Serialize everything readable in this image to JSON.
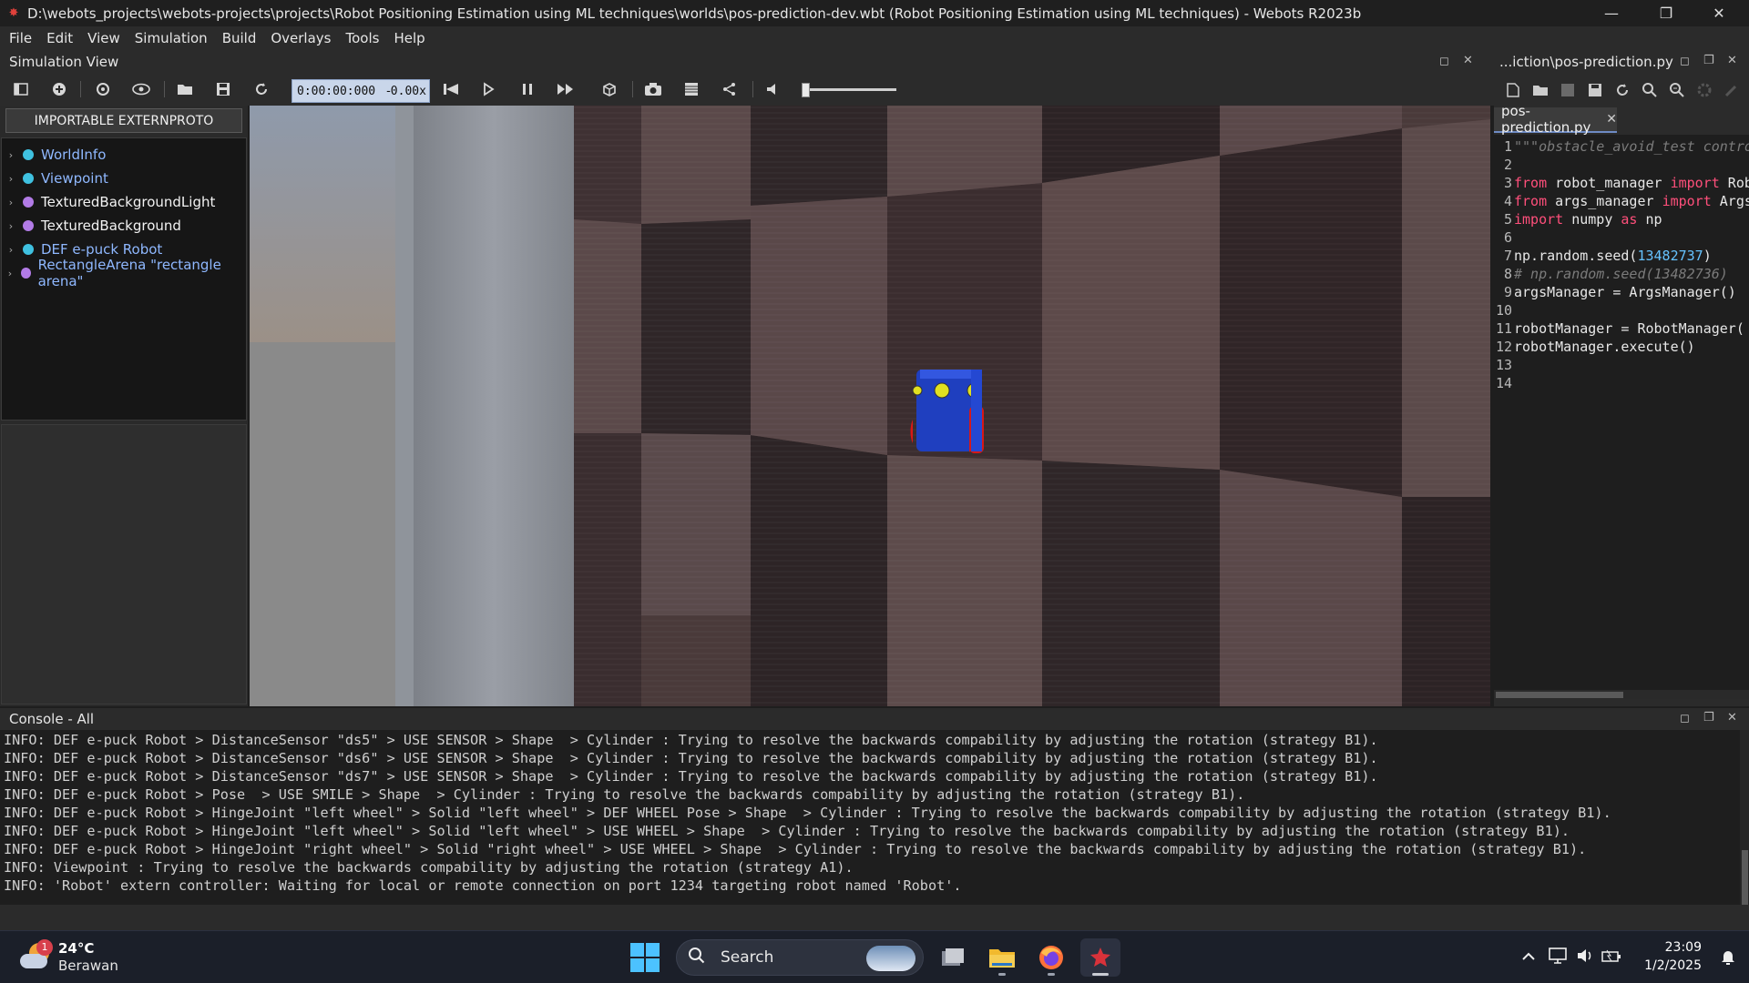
{
  "window": {
    "title": "D:\\webots_projects\\webots-projects\\projects\\Robot Positioning Estimation using ML techniques\\worlds\\pos-prediction-dev.wbt (Robot Positioning Estimation using ML techniques) - Webots R2023b",
    "minimize": "—",
    "restore": "❐",
    "close": "✕"
  },
  "menu": [
    "File",
    "Edit",
    "View",
    "Simulation",
    "Build",
    "Overlays",
    "Tools",
    "Help"
  ],
  "simulation_view": {
    "title": "Simulation View",
    "time": "0:00:00:000",
    "time_separator": "-",
    "speed": "0.00x",
    "volume_level": 0.0
  },
  "scene_tree": {
    "externproto_button": "IMPORTABLE EXTERNPROTO",
    "items": [
      {
        "label": "WorldInfo",
        "color": "#3fc1e0",
        "label_color": "#8fb8ff"
      },
      {
        "label": "Viewpoint",
        "color": "#3fc1e0",
        "label_color": "#8fb8ff"
      },
      {
        "label": "TexturedBackgroundLight",
        "color": "#b27be6",
        "label_color": "#f2f2f2"
      },
      {
        "label": "TexturedBackground",
        "color": "#b27be6",
        "label_color": "#f2f2f2"
      },
      {
        "label": "DEF e-puck Robot",
        "color": "#3fc1e0",
        "label_color": "#8fb8ff"
      },
      {
        "label": "RectangleArena \"rectangle arena\"",
        "color": "#b27be6",
        "label_color": "#8fb8ff"
      }
    ]
  },
  "editor": {
    "title": "...iction\\pos-prediction.py",
    "tab": "pos-prediction.py",
    "tab_close": "✕",
    "lines": [
      {
        "n": "1",
        "parts": [
          {
            "t": "\"\"\"obstacle_avoid_test controller.\"\"\"",
            "c": "cmt"
          }
        ]
      },
      {
        "n": "2",
        "parts": []
      },
      {
        "n": "3",
        "parts": [
          {
            "t": "from",
            "c": "kw"
          },
          {
            "t": " robot_manager ",
            "c": ""
          },
          {
            "t": "import",
            "c": "kw"
          },
          {
            "t": " RobotManager",
            "c": ""
          }
        ]
      },
      {
        "n": "4",
        "parts": [
          {
            "t": "from",
            "c": "kw"
          },
          {
            "t": " args_manager ",
            "c": ""
          },
          {
            "t": "import",
            "c": "kw"
          },
          {
            "t": " ArgsManager",
            "c": ""
          }
        ]
      },
      {
        "n": "5",
        "parts": [
          {
            "t": "import",
            "c": "kw"
          },
          {
            "t": " numpy ",
            "c": ""
          },
          {
            "t": "as",
            "c": "kw"
          },
          {
            "t": " np",
            "c": ""
          }
        ]
      },
      {
        "n": "6",
        "parts": []
      },
      {
        "n": "7",
        "parts": [
          {
            "t": "np.random.seed(",
            "c": ""
          },
          {
            "t": "13482737",
            "c": "num"
          },
          {
            "t": ")",
            "c": ""
          }
        ]
      },
      {
        "n": "8",
        "parts": [
          {
            "t": "# np.random.seed(13482736)",
            "c": "cmt"
          }
        ]
      },
      {
        "n": "9",
        "parts": [
          {
            "t": "argsManager = ArgsManager()",
            "c": ""
          }
        ]
      },
      {
        "n": "10",
        "parts": []
      },
      {
        "n": "11",
        "parts": [
          {
            "t": "robotManager = RobotManager(",
            "c": ""
          }
        ]
      },
      {
        "n": "12",
        "parts": [
          {
            "t": "robotManager.execute()",
            "c": ""
          }
        ]
      },
      {
        "n": "13",
        "parts": []
      },
      {
        "n": "14",
        "parts": []
      }
    ]
  },
  "console": {
    "title": "Console - All",
    "lines": [
      "INFO: DEF e-puck Robot > DistanceSensor \"ds5\" > USE SENSOR > Shape  > Cylinder : Trying to resolve the backwards compability by adjusting the rotation (strategy B1).",
      "INFO: DEF e-puck Robot > DistanceSensor \"ds6\" > USE SENSOR > Shape  > Cylinder : Trying to resolve the backwards compability by adjusting the rotation (strategy B1).",
      "INFO: DEF e-puck Robot > DistanceSensor \"ds7\" > USE SENSOR > Shape  > Cylinder : Trying to resolve the backwards compability by adjusting the rotation (strategy B1).",
      "INFO: DEF e-puck Robot > Pose  > USE SMILE > Shape  > Cylinder : Trying to resolve the backwards compability by adjusting the rotation (strategy B1).",
      "INFO: DEF e-puck Robot > HingeJoint \"left wheel\" > Solid \"left wheel\" > DEF WHEEL Pose > Shape  > Cylinder : Trying to resolve the backwards compability by adjusting the rotation (strategy B1).",
      "INFO: DEF e-puck Robot > HingeJoint \"left wheel\" > Solid \"left wheel\" > USE WHEEL > Shape  > Cylinder : Trying to resolve the backwards compability by adjusting the rotation (strategy B1).",
      "INFO: DEF e-puck Robot > HingeJoint \"right wheel\" > Solid \"right wheel\" > USE WHEEL > Shape  > Cylinder : Trying to resolve the backwards compability by adjusting the rotation (strategy B1).",
      "INFO: Viewpoint : Trying to resolve the backwards compability by adjusting the rotation (strategy A1).",
      "INFO: 'Robot' extern controller: Waiting for local or remote connection on port 1234 targeting robot named 'Robot'."
    ]
  },
  "taskbar": {
    "weather_temp": "24°C",
    "weather_cond": "Berawan",
    "weather_badge": "1",
    "search_label": "Search",
    "time": "23:09",
    "date": "1/2/2025"
  },
  "icons": {
    "search": "search-icon",
    "chevron": "chevron-right-icon"
  },
  "colors": {
    "accent": "#4cc2ff",
    "keyword": "#ff4f7b",
    "number": "#66c3ff",
    "robot_body": "#1f3fbf",
    "robot_wheel": "#d81818"
  }
}
